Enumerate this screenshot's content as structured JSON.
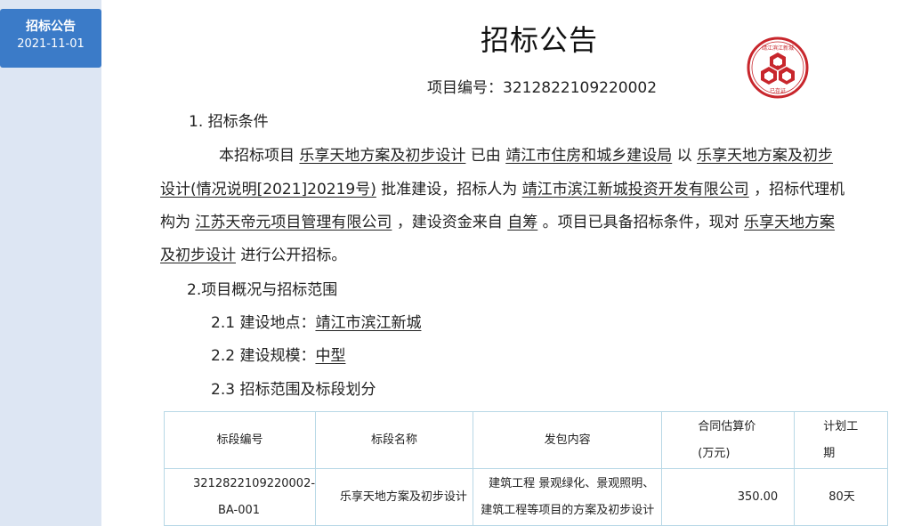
{
  "sidebar": {
    "tab_label": "招标公告",
    "tab_date": "2021-11-01"
  },
  "header": {
    "title": "招标公告",
    "project_no_label": "项目编号：",
    "project_no": "3212822109220002"
  },
  "seal": {
    "icon": "official-seal-icon",
    "color": "#c8262c",
    "text_top": "靖江滨江新城",
    "text_bottom": "已存证"
  },
  "section1": {
    "heading": "1. 招标条件",
    "p1_a": "本招标项目",
    "p1_project": "乐享天地方案及初步设计",
    "p1_b": "已由",
    "p1_approver": "靖江市住房和城乡建设局",
    "p1_c": "以",
    "p1_doc_a": "乐享天地方案及初步",
    "p2_doc_b": "设计(情况说明[2021]20219号)",
    "p2_a": "批准建设，招标人为",
    "p2_tenderer": "靖江市滨江新城投资开发有限公司",
    "p2_b": "，招标代理机",
    "p3_a": "构为",
    "p3_agent": "江苏天帝元项目管理有限公司",
    "p3_b": "，建设资金来自",
    "p3_fund": "自筹",
    "p3_c": "。项目已具备招标条件，现对",
    "p3_project_a": "乐享天地方案",
    "p4_project_b": "及初步设计",
    "p4_a": "进行公开招标。"
  },
  "section2": {
    "heading": "2.项目概况与招标范围",
    "loc_label": "2.1 建设地点：",
    "loc_value": "靖江市滨江新城",
    "scale_label": "2.2 建设规模：",
    "scale_value": "中型",
    "scope_label": "2.3 招标范围及标段划分"
  },
  "table": {
    "headers": {
      "code": "标段编号",
      "name": "标段名称",
      "content": "发包内容",
      "price_a": "合同估算价",
      "price_b": "(万元)",
      "period_a": "计划工",
      "period_b": "期"
    },
    "row": {
      "code_a": "3212822109220002-",
      "code_b": "BA-001",
      "name": "乐享天地方案及初步设计",
      "content_a": "建筑工程 景观绿化、景观照明、",
      "content_b": "建筑工程等项目的方案及初步设计",
      "price": "350.00",
      "period": "80天"
    }
  }
}
